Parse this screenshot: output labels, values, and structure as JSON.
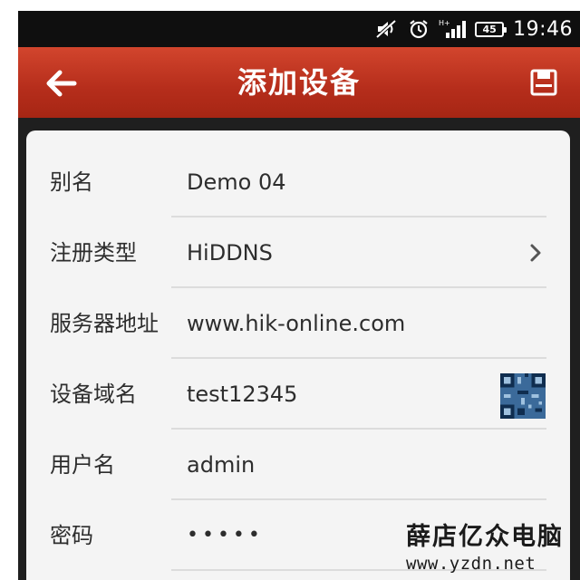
{
  "status_bar": {
    "icons": [
      "mute-icon",
      "alarm-icon",
      "signal-hplus-icon",
      "battery-icon"
    ],
    "battery_level": "45",
    "network_label": "H+",
    "time": "19:46"
  },
  "header": {
    "title": "添加设备",
    "back_icon": "arrow-left-icon",
    "save_icon": "floppy-disk-icon",
    "color": "#c0361f"
  },
  "form": {
    "rows": [
      {
        "label": "别名",
        "value": "Demo 04"
      },
      {
        "label": "注册类型",
        "value": "HiDDNS",
        "trailing": "chevron-right-icon"
      },
      {
        "label": "服务器地址",
        "value": "www.hik-online.com"
      },
      {
        "label": "设备域名",
        "value": "test12345",
        "trailing": "qr-code-icon"
      },
      {
        "label": "用户名",
        "value": "admin"
      },
      {
        "label": "密码",
        "value": "•••••"
      }
    ]
  },
  "watermark": {
    "text_cn": "薛店亿众电脑",
    "url": "www.yzdn.net"
  }
}
